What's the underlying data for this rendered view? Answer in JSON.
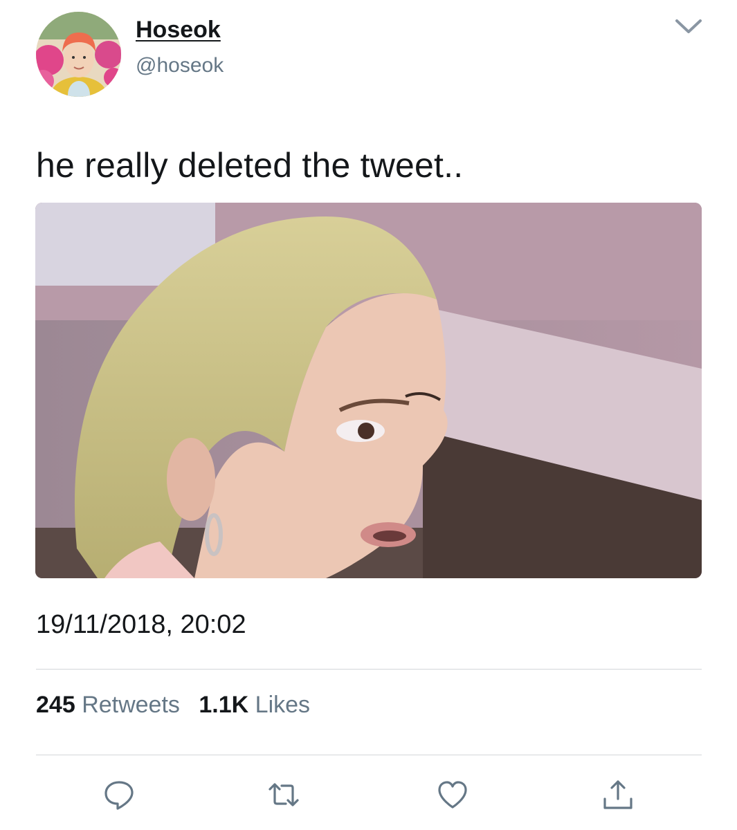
{
  "author": {
    "display_name": "Hoseok",
    "handle": "@hoseok"
  },
  "tweet": {
    "text": "he really deleted the tweet..",
    "timestamp": "19/11/2018, 20:02"
  },
  "stats": {
    "retweets_count": "245",
    "retweets_label": "Retweets",
    "likes_count": "1.1K",
    "likes_label": "Likes"
  },
  "icons": {
    "menu": "chevron-down-icon",
    "reply": "reply-icon",
    "retweet": "retweet-icon",
    "like": "heart-icon",
    "share": "share-icon"
  },
  "colors": {
    "text": "#14171a",
    "secondary": "#657786",
    "divider": "#d3d6d9",
    "icon": "#657786"
  }
}
